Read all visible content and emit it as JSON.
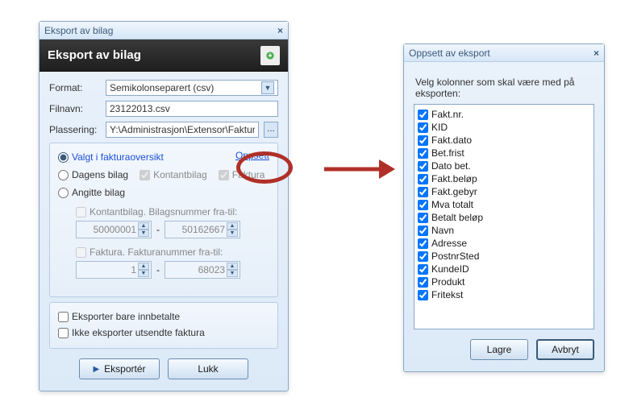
{
  "main": {
    "title": "Eksport av bilag",
    "header": "Eksport av bilag",
    "labels": {
      "format": "Format:",
      "filnavn": "Filnavn:",
      "plassering": "Plassering:"
    },
    "values": {
      "format": "Semikolonseparert (csv)",
      "filnavn": "23122013.csv",
      "plassering": "Y:\\Administrasjon\\Extensor\\Fakturagr..."
    },
    "link": "Oppsett",
    "radios": {
      "valgt": "Valgt i fakturaoversikt",
      "dagens": "Dagens bilag",
      "angitte": "Angitte bilag"
    },
    "subchecks": {
      "kontant": "Kontantbilag",
      "faktura": "Faktura"
    },
    "ranges": {
      "kontant_label": "Kontantbilag. Bilagsnummer fra-til:",
      "kontant_from": "50000001",
      "kontant_to": "50162667",
      "faktura_label": "Faktura. Fakturanummer fra-til:",
      "faktura_from": "1",
      "faktura_to": "68023",
      "dash": "-"
    },
    "exportChecks": {
      "innbetalte": "Eksporter bare innbetalte",
      "utsendte": "Ikke eksporter utsendte faktura"
    },
    "buttons": {
      "eksporter": "Eksportér",
      "lukk": "Lukk"
    }
  },
  "setup": {
    "title": "Oppsett av eksport",
    "instruction": "Velg kolonner som skal være med på eksporten:",
    "columns": [
      "Fakt.nr.",
      "KID",
      "Fakt.dato",
      "Bet.frist",
      "Dato bet.",
      "Fakt.beløp",
      "Fakt.gebyr",
      "Mva totalt",
      "Betalt beløp",
      "Navn",
      "Adresse",
      "PostnrSted",
      "KundeID",
      "Produkt",
      "Fritekst"
    ],
    "buttons": {
      "lagre": "Lagre",
      "avbryt": "Avbryt"
    }
  }
}
